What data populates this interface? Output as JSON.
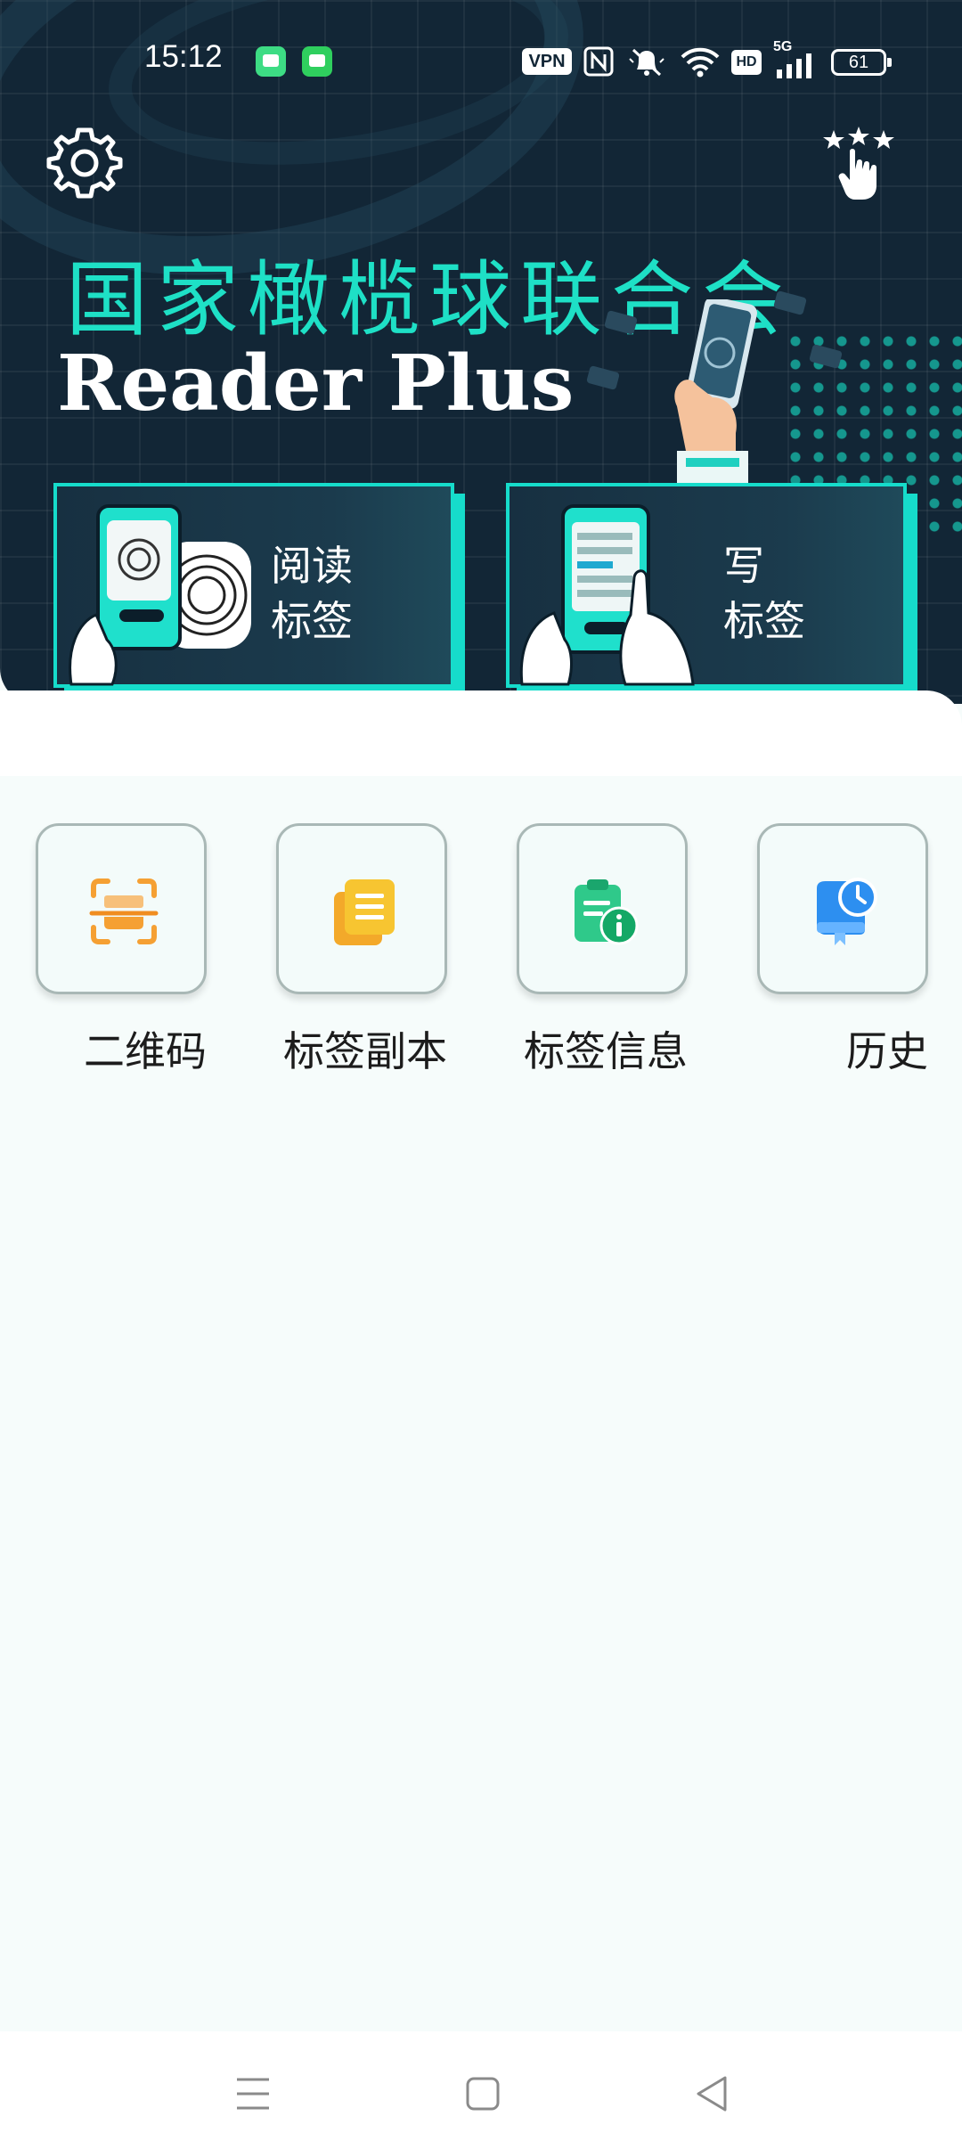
{
  "status_bar": {
    "time": "15:12",
    "vpn": "VPN",
    "hd": "HD",
    "network": "5G",
    "battery": "61",
    "icons": [
      "android-icon",
      "messages-icon",
      "nfc-icon",
      "mute-icon",
      "wifi-icon",
      "signal-icon"
    ]
  },
  "hero": {
    "title_cn": "国家橄榄球联合会",
    "title_en": "Reader Plus",
    "settings_icon": "gear-icon",
    "rate_icon": "stars-tap-icon"
  },
  "features": {
    "read": {
      "line1": "阅读",
      "line2": "标签"
    },
    "write": {
      "line1": "写",
      "line2": "标签"
    }
  },
  "tools": [
    {
      "label": "二维码",
      "icon": "qr-scan-icon",
      "color": "#f5a033"
    },
    {
      "label": "标签副本",
      "icon": "copy-icon",
      "color": "#f7c531"
    },
    {
      "label": "标签信息",
      "icon": "clipboard-info-icon",
      "color": "#22b77b"
    },
    {
      "label": "历史",
      "icon": "history-book-icon",
      "color": "#2d8ff0"
    }
  ],
  "colors": {
    "hero_bg": "#122636",
    "accent": "#16dccb",
    "title_cn": "#1ee0c6",
    "page_bg": "#f6fcfb"
  },
  "nav": [
    "menu-icon",
    "home-icon",
    "back-icon"
  ]
}
